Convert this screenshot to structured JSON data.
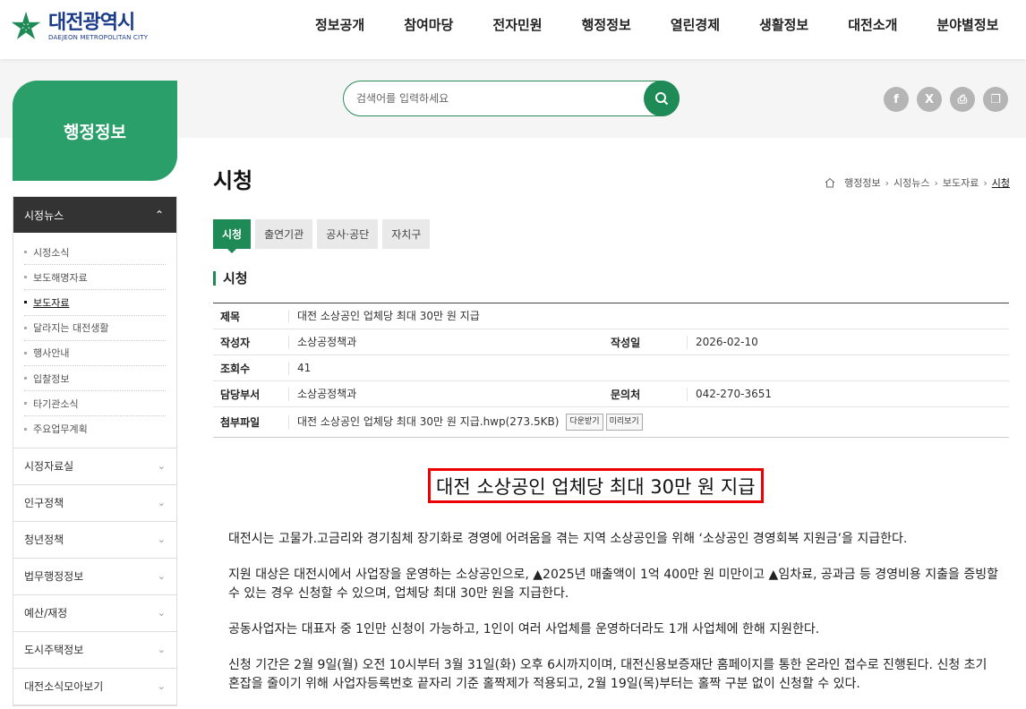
{
  "header": {
    "logo_kr": "대전광역시",
    "logo_en": "DAEJEON METROPOLITAN CITY",
    "nav": [
      "정보공개",
      "참여마당",
      "전자민원",
      "행정정보",
      "열린경제",
      "생활정보",
      "대전소개",
      "분야별정보"
    ]
  },
  "search": {
    "placeholder": "검색어를 입력하세요"
  },
  "share": [
    "f",
    "X",
    "⎙",
    "❐"
  ],
  "sidebar": {
    "title": "행정정보",
    "open_menu": "시정뉴스",
    "sub_items": [
      "시정소식",
      "보도해명자료",
      "보도자료",
      "달라지는 대전생활",
      "행사안내",
      "입찰정보",
      "타기관소식",
      "주요업무계획"
    ],
    "items": [
      "시정자료실",
      "인구정책",
      "청년정책",
      "법무행정정보",
      "예산/재정",
      "도시주택정보",
      "대전소식모아보기"
    ]
  },
  "page": {
    "title": "시청",
    "breadcrumb": [
      "행정정보",
      "시정뉴스",
      "보도자료",
      "시청"
    ],
    "tabs": [
      "시청",
      "출연기관",
      "공사·공단",
      "자치구"
    ],
    "section_title": "시청"
  },
  "info": {
    "labels": {
      "subject": "제목",
      "author": "작성자",
      "date": "작성일",
      "views": "조회수",
      "dept": "담당부서",
      "contact": "문의처",
      "attach": "첨부파일"
    },
    "subject": "대전 소상공인 업체당 최대 30만 원 지급",
    "author": "소상공정책과",
    "date": "2026-02-10",
    "views": "41",
    "dept": "소상공정책과",
    "contact": "042-270-3651",
    "attachment": "대전 소상공인 업체당 최대 30만 원 지급.hwp(273.5KB)",
    "download_label": "다운받기",
    "preview_label": "미리보기"
  },
  "article": {
    "title": "대전 소상공인 업체당 최대 30만 원 지급",
    "paragraphs": [
      "대전시는 고물가.고금리와 경기침체 장기화로 경영에 어려움을 겪는 지역 소상공인을 위해 ‘소상공인 경영회복 지원금’을 지급한다.",
      "지원 대상은 대전시에서 사업장을 운영하는 소상공인으로, ▲2025년 매출액이 1억 400만 원 미만이고 ▲임차료, 공과금 등 경영비용 지출을 증빙할 수 있는 경우 신청할 수 있으며, 업체당 최대 30만 원을 지급한다.",
      "공동사업자는 대표자 중 1인만 신청이 가능하고, 1인이 여러 사업체를 운영하더라도 1개 사업체에 한해 지원한다.",
      "신청 기간은 2월 9일(월) 오전 10시부터 3월 31일(화) 오후 6시까지이며, 대전신용보증재단 홈페이지를 통한 온라인 접수로 진행된다. 신청 초기 혼잡을 줄이기 위해 사업자등록번호 끝자리 기준 홀짝제가 적용되고, 2월 19일(목)부터는 홀짝 구분 없이 신청할 수 있다."
    ]
  },
  "colors": {
    "brand_green": "#1e8a55",
    "side_green": "#2a9f6a",
    "logo_blue": "#1a3a8a",
    "highlight_red": "#ee0000"
  }
}
